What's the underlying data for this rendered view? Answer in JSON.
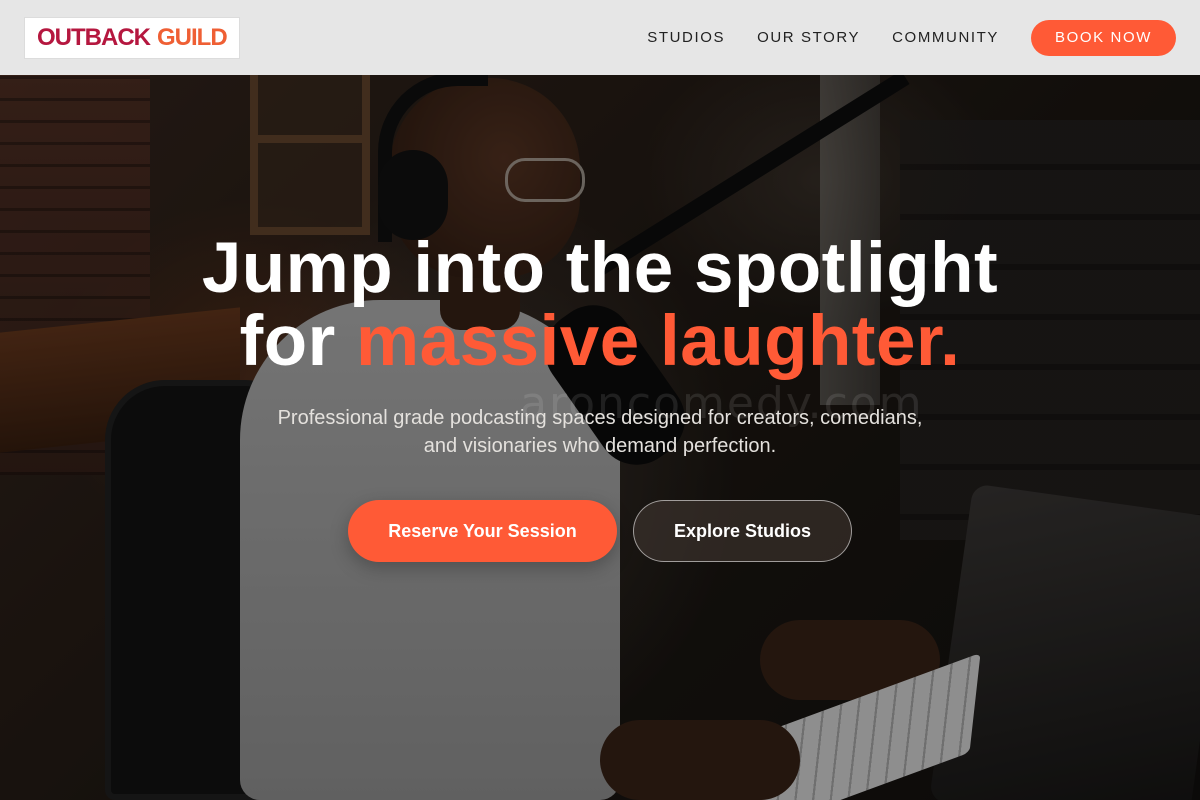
{
  "nav": {
    "logo_part1": "OUTBACK",
    "logo_part2": "GUILD",
    "links": [
      "STUDIOS",
      "OUR STORY",
      "COMMUNITY"
    ],
    "cta_label": "BOOK NOW"
  },
  "hero": {
    "headline_line1": "Jump into the spotlight",
    "headline_line2_prefix": "for ",
    "headline_line2_accent": "massive laughter.",
    "subheadline": "Professional grade podcasting spaces designed for creators, comedians, and visionaries who demand perfection.",
    "primary_cta": "Reserve Your Session",
    "secondary_cta": "Explore Studios",
    "watermark": "aroncomedy.com"
  },
  "colors": {
    "accent": "#ff5a36",
    "logo_red": "#b5173f",
    "logo_orange": "#ef5f34",
    "nav_bg": "#e6e6e6"
  }
}
